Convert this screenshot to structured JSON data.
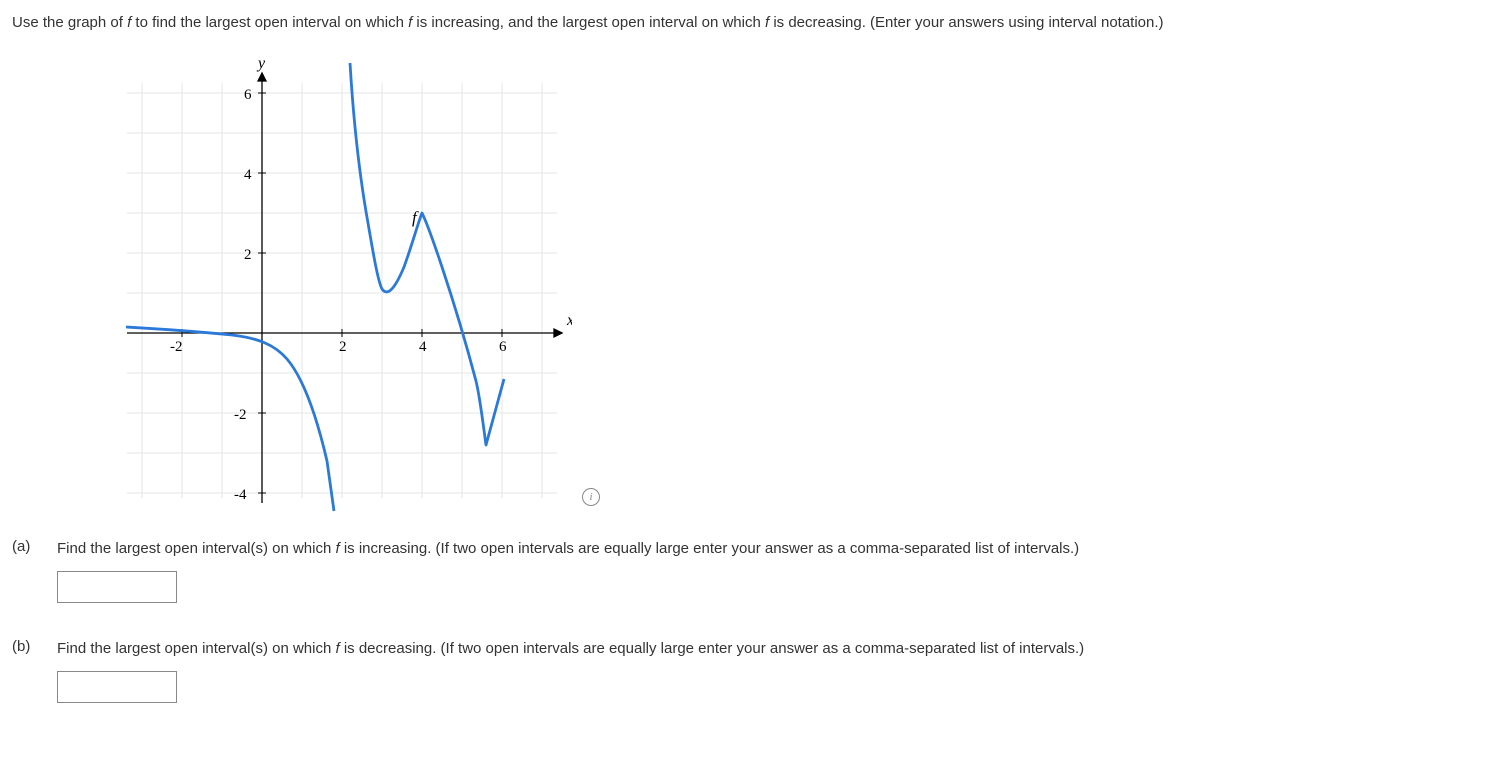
{
  "question_main": "Use the graph of f to find the largest open interval on which f is increasing, and the largest open interval on which f is decreasing. (Enter your answers using interval notation.)",
  "part_a": {
    "label": "(a)",
    "text": "Find the largest open interval(s) on which f is increasing. (If two open intervals are equally large enter your answer as a comma-separated list of intervals.)",
    "value": ""
  },
  "part_b": {
    "label": "(b)",
    "text": "Find the largest open interval(s) on which f is decreasing. (If two open intervals are equally large enter your answer as a comma-separated list of intervals.)",
    "value": ""
  },
  "info_icon_glyph": "i",
  "chart_data": {
    "type": "line",
    "xlabel": "x",
    "ylabel": "y",
    "curve_label": "f",
    "x_ticks": [
      -2,
      2,
      4,
      6
    ],
    "y_ticks": [
      -4,
      -2,
      2,
      4,
      6
    ],
    "xlim": [
      -3.5,
      7.5
    ],
    "ylim": [
      -5,
      7
    ],
    "grid": true,
    "pieces": [
      {
        "description": "left branch, slightly decreasing from upper-left approaching origin",
        "points": [
          {
            "x": -3.4,
            "y": 0.15
          },
          {
            "x": -2.0,
            "y": 0.0
          },
          {
            "x": -1.0,
            "y": -0.1
          },
          {
            "x": 0.0,
            "y": -0.25
          },
          {
            "x": 0.6,
            "y": -0.65
          },
          {
            "x": 1.2,
            "y": -1.6
          },
          {
            "x": 1.6,
            "y": -3.2
          },
          {
            "x": 1.8,
            "y": -5.0
          }
        ]
      },
      {
        "description": "right branch from top, dips to local min near x=3, rises to local max near x=4, falls to cusp near x=5.6, rises again",
        "points": [
          {
            "x": 2.2,
            "y": 7.0
          },
          {
            "x": 2.35,
            "y": 4.6
          },
          {
            "x": 2.55,
            "y": 2.6
          },
          {
            "x": 2.8,
            "y": 1.45
          },
          {
            "x": 3.0,
            "y": 1.1
          },
          {
            "x": 3.3,
            "y": 1.3
          },
          {
            "x": 3.6,
            "y": 2.0
          },
          {
            "x": 3.85,
            "y": 2.8
          },
          {
            "x": 4.0,
            "y": 3.0
          },
          {
            "x": 4.15,
            "y": 2.8
          },
          {
            "x": 4.4,
            "y": 2.0
          },
          {
            "x": 4.7,
            "y": 0.8
          },
          {
            "x": 5.0,
            "y": -0.5
          },
          {
            "x": 5.3,
            "y": -1.6
          },
          {
            "x": 5.6,
            "y": -2.8
          },
          {
            "x": 5.8,
            "y": -2.0
          },
          {
            "x": 6.05,
            "y": -1.1
          }
        ]
      }
    ]
  }
}
